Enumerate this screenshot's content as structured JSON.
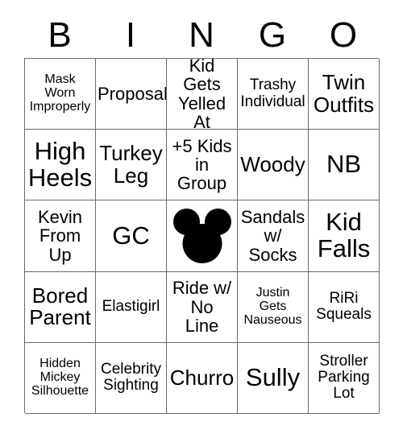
{
  "header": {
    "letters": [
      "B",
      "I",
      "N",
      "G",
      "O"
    ]
  },
  "grid": {
    "rows": 5,
    "columns": 5,
    "cells": [
      {
        "text": "Mask\nWorn\nImproperly",
        "size": "fs-sm",
        "type": "text"
      },
      {
        "text": "Proposal",
        "size": "fs-lg",
        "type": "text"
      },
      {
        "text": "Kid Gets\nYelled At",
        "size": "fs-lg",
        "type": "text"
      },
      {
        "text": "Trashy\nIndividual",
        "size": "fs-md",
        "type": "text"
      },
      {
        "text": "Twin\nOutfits",
        "size": "fs-xl",
        "type": "text"
      },
      {
        "text": "High\nHeels",
        "size": "fs-xxl",
        "type": "text"
      },
      {
        "text": "Turkey\nLeg",
        "size": "fs-xl",
        "type": "text"
      },
      {
        "text": "+5 Kids\nin\nGroup",
        "size": "fs-lg",
        "type": "text"
      },
      {
        "text": "Woody",
        "size": "fs-xl",
        "type": "text"
      },
      {
        "text": "NB",
        "size": "fs-xxl",
        "type": "text"
      },
      {
        "text": "Kevin\nFrom\nUp",
        "size": "fs-lg",
        "type": "text"
      },
      {
        "text": "GC",
        "size": "fs-xxl",
        "type": "text"
      },
      {
        "text": "",
        "size": "fs-md",
        "type": "free-space",
        "icon": "mickey-mouse-silhouette-icon"
      },
      {
        "text": "Sandals\nw/\nSocks",
        "size": "fs-lg",
        "type": "text"
      },
      {
        "text": "Kid\nFalls",
        "size": "fs-xxl",
        "type": "text"
      },
      {
        "text": "Bored\nParent",
        "size": "fs-xl",
        "type": "text"
      },
      {
        "text": "Elastigirl",
        "size": "fs-md",
        "type": "text"
      },
      {
        "text": "Ride w/\nNo\nLine",
        "size": "fs-lg",
        "type": "text"
      },
      {
        "text": "Justin\nGets\nNauseous",
        "size": "fs-sm",
        "type": "text"
      },
      {
        "text": "RiRi\nSqueals",
        "size": "fs-md",
        "type": "text"
      },
      {
        "text": "Hidden\nMickey\nSilhouette",
        "size": "fs-sm",
        "type": "text"
      },
      {
        "text": "Celebrity\nSighting",
        "size": "fs-md",
        "type": "text"
      },
      {
        "text": "Churro",
        "size": "fs-xl",
        "type": "text"
      },
      {
        "text": "Sully",
        "size": "fs-xxl",
        "type": "text"
      },
      {
        "text": "Stroller\nParking\nLot",
        "size": "fs-md",
        "type": "text"
      }
    ]
  },
  "colors": {
    "background": "#ffffff",
    "text": "#000000",
    "grid_line": "#6b6b6b",
    "free_space": "#000000"
  }
}
